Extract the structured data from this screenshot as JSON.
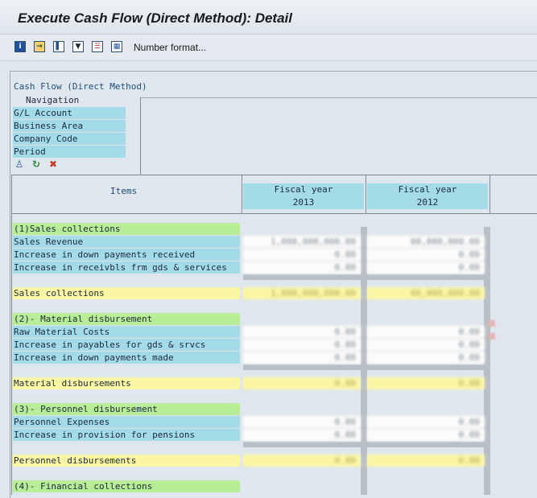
{
  "window": {
    "title": "Execute Cash Flow (Direct Method): Detail"
  },
  "toolbar": {
    "icons": [
      "info-icon",
      "export-icon",
      "chart-icon",
      "filter-icon",
      "hierarchy-icon",
      "table-icon"
    ],
    "number_format_label": "Number format..."
  },
  "report": {
    "title": "Cash Flow (Direct Method)",
    "navigation": {
      "legend": "Navigation",
      "items": [
        "G/L Account",
        "Business Area",
        "Company Code",
        "Period"
      ]
    },
    "columns": {
      "items_label": "Items",
      "fiscal": [
        {
          "label": "Fiscal year",
          "year": "2013"
        },
        {
          "label": "Fiscal year",
          "year": "2012"
        }
      ]
    },
    "rows": [
      {
        "label": "(1)Sales collections",
        "kind": "group",
        "v1": "",
        "v2": ""
      },
      {
        "label": "Sales Revenue",
        "kind": "detail",
        "v1": "1,000,000,000.00",
        "v2": "00,000,000.00"
      },
      {
        "label": "Increase in down payments received",
        "kind": "detail",
        "v1": "0.00",
        "v2": "0.00"
      },
      {
        "label": "Increase in receivbls frm gds & services",
        "kind": "detail",
        "v1": "0.00",
        "v2": "0.00"
      },
      {
        "label": "Sales collections",
        "kind": "total",
        "v1": "1,000,000,000.00",
        "v2": "00,000,000.00"
      },
      {
        "label": "(2)- Material disbursement",
        "kind": "group",
        "v1": "",
        "v2": ""
      },
      {
        "label": "Raw Material Costs",
        "kind": "detail",
        "v1": "0.00",
        "v2": "0.00"
      },
      {
        "label": "Increase in payables for gds & srvcs",
        "kind": "detail",
        "v1": "0.00",
        "v2": "0.00"
      },
      {
        "label": "Increase in down payments made",
        "kind": "detail",
        "v1": "0.00",
        "v2": "0.00"
      },
      {
        "label": "Material disbursements",
        "kind": "total",
        "v1": "0.00",
        "v2": "0.00"
      },
      {
        "label": "(3)- Personnel disbursement",
        "kind": "group",
        "v1": "",
        "v2": ""
      },
      {
        "label": "Personnel Expenses",
        "kind": "detail",
        "v1": "0.00",
        "v2": "0.00"
      },
      {
        "label": "Increase in provision for pensions",
        "kind": "detail",
        "v1": "0.00",
        "v2": "0.00"
      },
      {
        "label": "Personnel disbursements",
        "kind": "total",
        "v1": "0.00",
        "v2": "0.00"
      },
      {
        "label": "(4)- Financial collections",
        "kind": "group",
        "v1": "",
        "v2": ""
      }
    ]
  },
  "colors": {
    "group": "#b9ec97",
    "detail": "#a3dbe9",
    "total": "#fbf6a4"
  }
}
